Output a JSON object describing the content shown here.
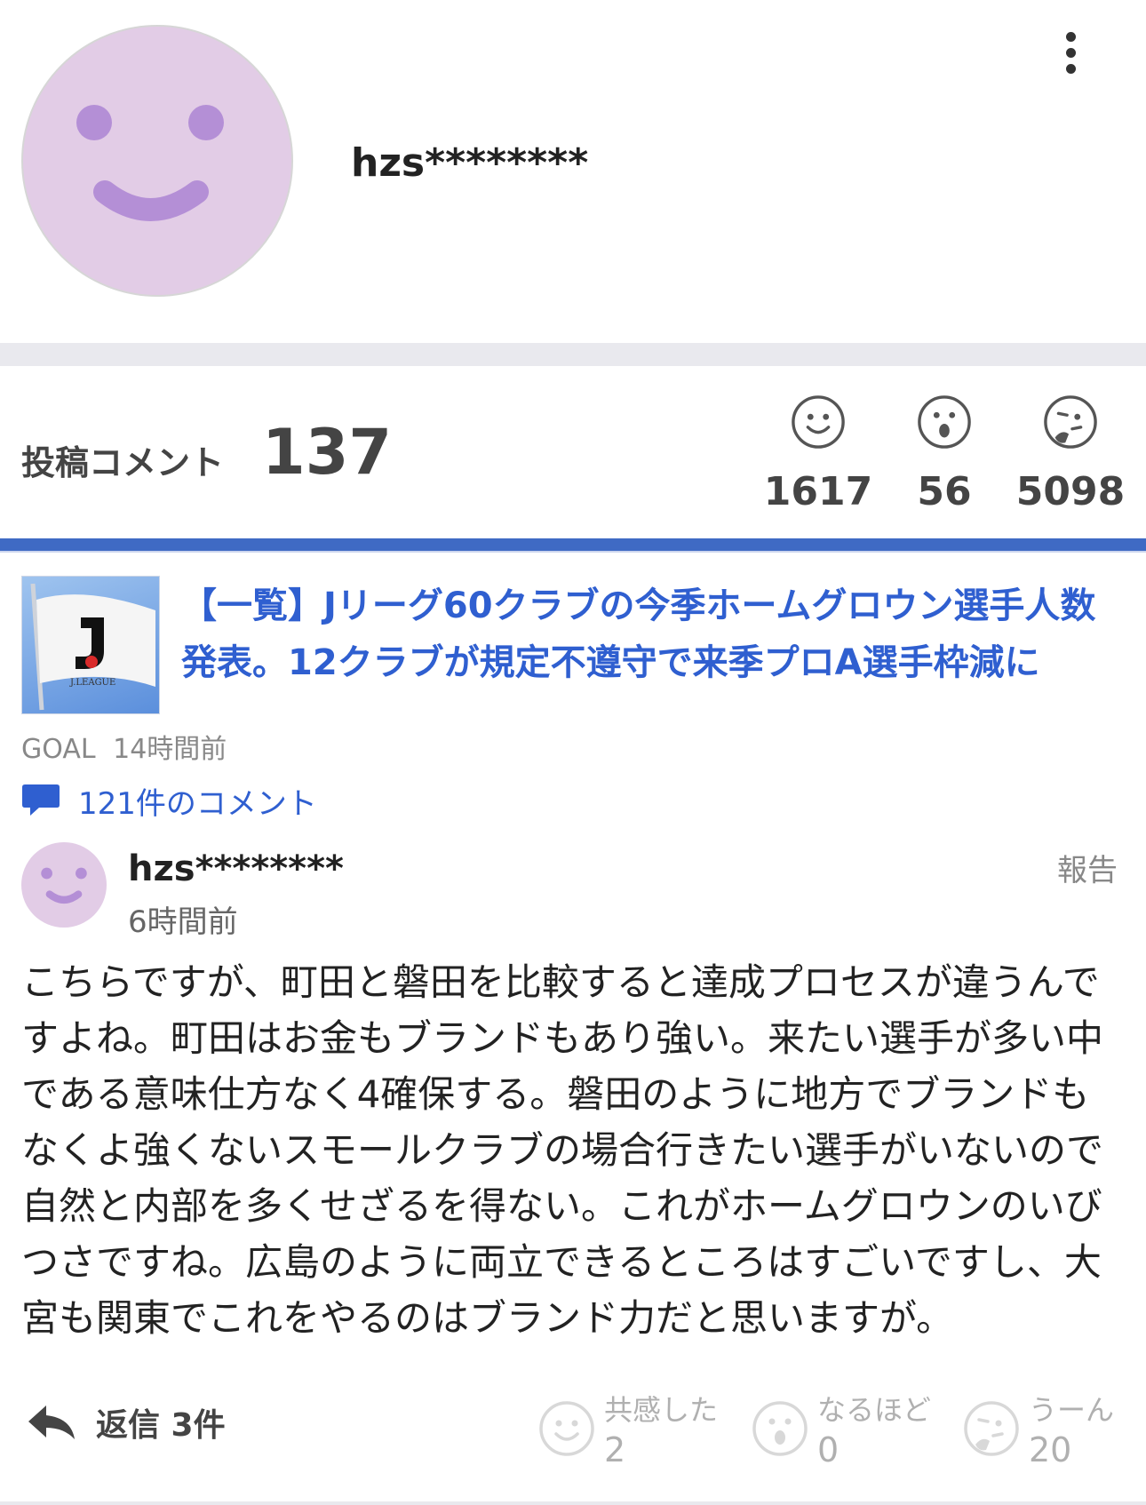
{
  "profile": {
    "username": "hzs********"
  },
  "stats": {
    "label": "投稿コメント",
    "count": "137",
    "reactions": [
      {
        "icon": "smile-face-icon",
        "count": "1617"
      },
      {
        "icon": "surprised-face-icon",
        "count": "56"
      },
      {
        "icon": "thinking-face-icon",
        "count": "5098"
      }
    ]
  },
  "article": {
    "title": "【一覧】Jリーグ60クラブの今季ホームグロウン選手人数発表。12クラブが規定不遵守で来季プロA選手枠減に",
    "thumbnail_text": "J.LEAGUE",
    "source": "GOAL",
    "time": "14時間前",
    "comments_link": "121件のコメント"
  },
  "comment": {
    "username": "hzs********",
    "time": "6時間前",
    "report_label": "報告",
    "body": "こちらですが、町田と磐田を比較すると達成プロセスが違うんですよね。町田はお金もブランドもあり強い。来たい選手が多い中である意味仕方なく4確保する。磐田のように地方でブランドもなくよ強くないスモールクラブの場合行きたい選手がいないので自然と内部を多くせざるを得ない。これがホームグロウンのいびつさですね。広島のように両立できるところはすごいですし、大宮も関東でこれをやるのはブランド力だと思いますが。",
    "reply_label": "返信 3件",
    "reactions": [
      {
        "icon": "smile-face-icon",
        "label": "共感した",
        "count": "2"
      },
      {
        "icon": "surprised-face-icon",
        "label": "なるほど",
        "count": "0"
      },
      {
        "icon": "thinking-face-icon",
        "label": "うーん",
        "count": "20"
      }
    ]
  },
  "colors": {
    "accent_blue": "#2f5fd0",
    "avatar_bg": "#e2cce6",
    "avatar_features": "#b48fd6"
  }
}
